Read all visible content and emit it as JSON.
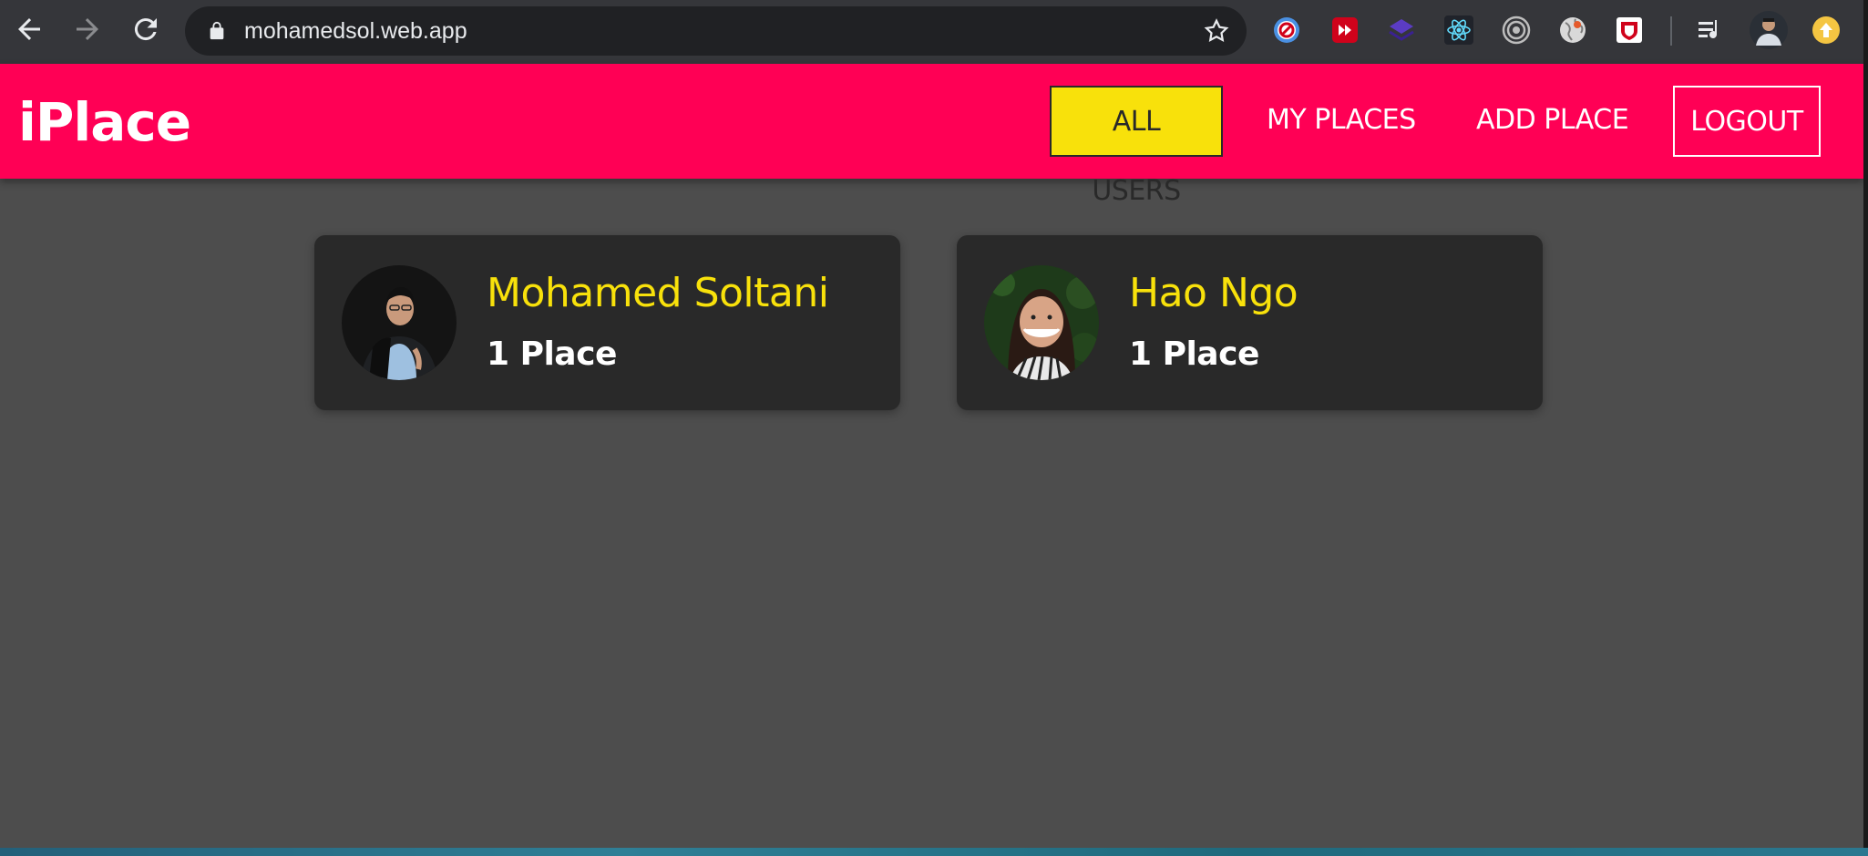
{
  "browser": {
    "url": "mohamedsol.web.app",
    "extensions": [
      "blocker-extension-icon",
      "media-extension-icon",
      "layers-extension-icon",
      "react-devtools-icon",
      "target-extension-icon",
      "globe-extension-icon",
      "shield-extension-icon",
      "media-queue-icon",
      "profile-avatar",
      "update-icon"
    ]
  },
  "header": {
    "logo": "iPlace",
    "nav": {
      "all_users": "ALL USERS",
      "my_places": "MY PLACES",
      "add_place": "ADD PLACE",
      "logout": "LOGOUT"
    }
  },
  "users": [
    {
      "name": "Mohamed Soltani",
      "places": "1 Place"
    },
    {
      "name": "Hao Ngo",
      "places": "1 Place"
    }
  ],
  "colors": {
    "header_bg": "#ff0055",
    "accent": "#f8e10b",
    "page_bg": "#4d4d4d",
    "card_bg": "#292929"
  }
}
